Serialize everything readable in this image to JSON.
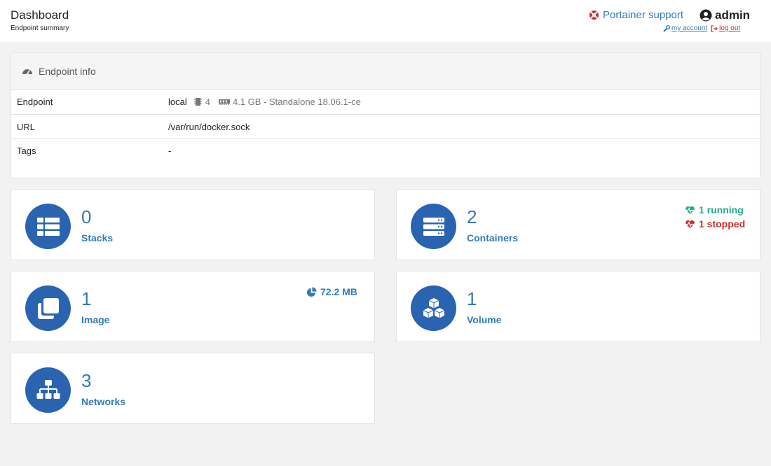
{
  "header": {
    "title": "Dashboard",
    "subtitle": "Endpoint summary",
    "support_label": "Portainer support",
    "username": "admin",
    "my_account": "my account",
    "log_out": "log out"
  },
  "endpoint_info": {
    "title": "Endpoint info",
    "rows": [
      {
        "key": "Endpoint",
        "name": "local",
        "cpu": "4",
        "memory": "4.1 GB - Standalone 18.06.1-ce"
      },
      {
        "key": "URL",
        "value": "/var/run/docker.sock"
      },
      {
        "key": "Tags",
        "value": "-"
      }
    ]
  },
  "tiles": {
    "stacks": {
      "count": "0",
      "label": "Stacks"
    },
    "containers": {
      "count": "2",
      "label": "Containers",
      "running": "1 running",
      "stopped": "1 stopped"
    },
    "images": {
      "count": "1",
      "label": "Image",
      "size": "72.2 MB"
    },
    "volumes": {
      "count": "1",
      "label": "Volume"
    },
    "networks": {
      "count": "3",
      "label": "Networks"
    }
  },
  "colors": {
    "accent": "#337ab7",
    "circle": "#2a64b0",
    "running": "#23ae89",
    "stopped": "#c9302c"
  },
  "icons": [
    "life-ring-icon",
    "user-circle-icon",
    "wrench-icon",
    "sign-out-icon",
    "tachometer-icon",
    "microchip-icon",
    "memory-icon",
    "th-list-icon",
    "server-icon",
    "clone-icon",
    "cubes-icon",
    "sitemap-icon",
    "heartbeat-icon",
    "pie-chart-icon"
  ]
}
